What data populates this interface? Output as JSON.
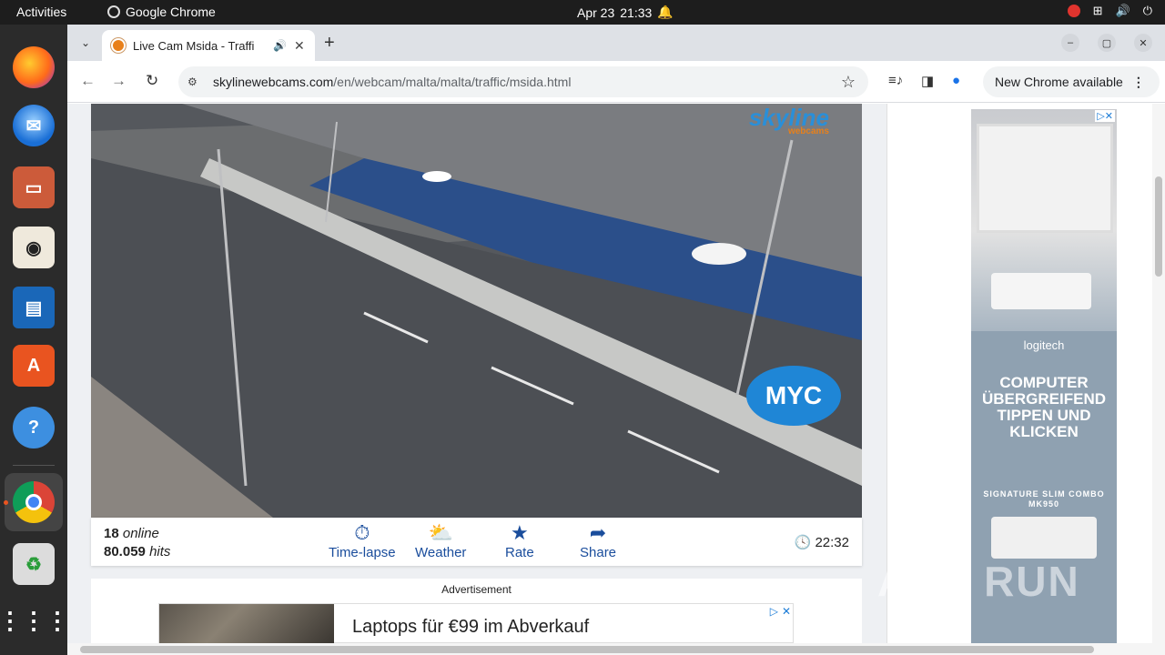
{
  "topbar": {
    "activities": "Activities",
    "app_name": "Google Chrome",
    "date": "Apr 23",
    "time": "21:33"
  },
  "dock": {
    "apps": [
      "firefox-icon",
      "thunderbird-icon",
      "files-icon",
      "rhythmbox-icon",
      "libreoffice-writer-icon",
      "app-center-icon",
      "help-icon",
      "chrome-icon",
      "trash-icon",
      "show-apps-icon"
    ]
  },
  "browser": {
    "tab_title": "Live Cam Msida - Traffi",
    "url_host": "skylinewebcams.com",
    "url_path": "/en/webcam/malta/malta/traffic/msida.html",
    "update_label": "New Chrome available"
  },
  "webcam": {
    "logo": "skyline",
    "logo_sub": "webcams",
    "sponsor_logo": "MYC",
    "online_count": "18",
    "online_label": "online",
    "hits_count": "80.059",
    "hits_label": "hits",
    "actions": [
      "Time-lapse",
      "Weather",
      "Rate",
      "Share"
    ],
    "local_time": "22:32"
  },
  "ads": {
    "bottom_label": "Advertisement",
    "bottom_text": "Laptops für €99 im Abverkauf",
    "side_brand": "logitech",
    "side_headline": "COMPUTER ÜBERGREIFEND TIPPEN UND KLICKEN",
    "side_product": "SIGNATURE SLIM COMBO MK950"
  },
  "watermark": "ANY RUN",
  "colors": {
    "accent": "#1a4d9c",
    "dock_active": "#e95420"
  }
}
